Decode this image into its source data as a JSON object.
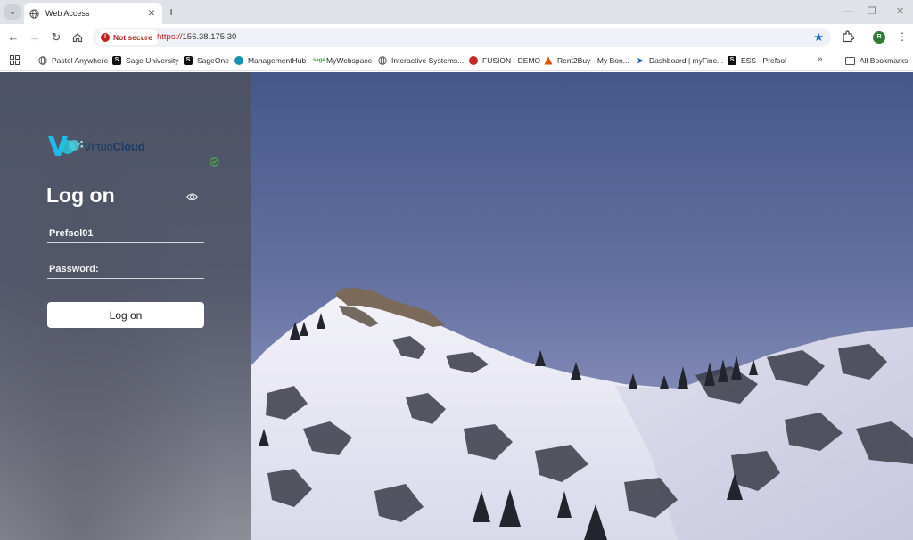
{
  "browser": {
    "tab_title": "Web Access",
    "security_label": "Not secure",
    "url_protocol": "https://",
    "url_host": "156.38.175.30",
    "profile_initial": "R"
  },
  "bookmarks": {
    "items": [
      {
        "label": "Pastel Anywhere",
        "icon": "globe-icon"
      },
      {
        "label": "Sage University",
        "icon": "sage-icon",
        "color": "#111111"
      },
      {
        "label": "SageOne",
        "icon": "sage-icon",
        "color": "#111111"
      },
      {
        "label": "ManagementHub",
        "icon": "hub-icon",
        "color": "#1b8fb0"
      },
      {
        "label": "MyWebspace",
        "icon": "sage-logo-icon",
        "color": "#13a538"
      },
      {
        "label": "Interactive Systems...",
        "icon": "globe-icon"
      },
      {
        "label": "FUSION - DEMO",
        "icon": "fusion-icon",
        "color": "#c62828"
      },
      {
        "label": "Rent2Buy - My Bon...",
        "icon": "triangle-icon",
        "color": "#e65100"
      },
      {
        "label": "Dashboard | myFinc...",
        "icon": "plane-icon",
        "color": "#1565c0"
      },
      {
        "label": "ESS - Prefsol",
        "icon": "sage-icon",
        "color": "#111111"
      }
    ],
    "all_bookmarks_label": "All Bookmarks"
  },
  "login": {
    "logo_prefix": "Virtuo",
    "logo_bold": "Cloud",
    "heading": "Log on",
    "username_value": "Prefsol01",
    "password_placeholder": "Password:",
    "submit_label": "Log on"
  },
  "colors": {
    "panel": "#525769",
    "sky": "#4f6089",
    "not_secure": "#c5221f",
    "star": "#1a66d2",
    "logo_accent": "#22b8e8"
  }
}
